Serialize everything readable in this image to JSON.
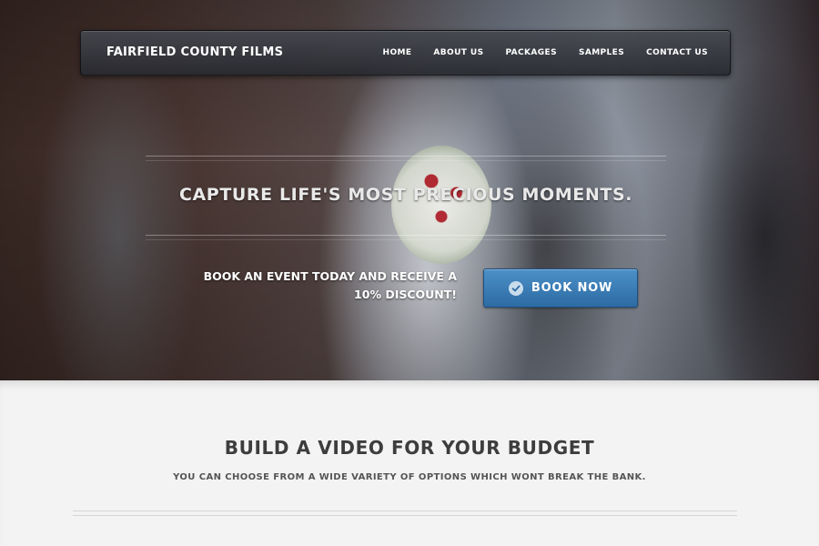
{
  "brand": "FAIRFIELD COUNTY FILMS",
  "nav": [
    "HOME",
    "ABOUT US",
    "PACKAGES",
    "SAMPLES",
    "CONTACT US"
  ],
  "hero": {
    "tagline": "CAPTURE LIFE'S MOST PRECIOUS MOMENTS.",
    "promo_line1": "BOOK AN EVENT TODAY AND RECEIVE A",
    "promo_line2": "10% DISCOUNT!",
    "book_button": "BOOK NOW",
    "book_icon": "check-circle-icon"
  },
  "budget": {
    "title": "BUILD A VIDEO FOR YOUR BUDGET",
    "subtitle": "YOU CAN CHOOSE FROM A WIDE VARIETY OF OPTIONS WHICH WONT BREAK THE BANK."
  },
  "colors": {
    "button_blue": "#2d6ba3",
    "navbar": "#2e3036",
    "heading_text": "#3d3d3d"
  }
}
